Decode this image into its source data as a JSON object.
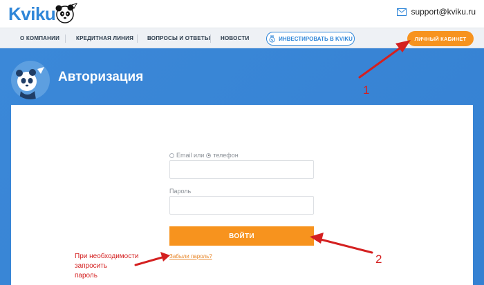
{
  "header": {
    "logo_text": "Kviku",
    "support_email": "support@kviku.ru"
  },
  "nav": {
    "items": [
      "О КОМПАНИИ",
      "КРЕДИТНАЯ ЛИНИЯ",
      "ВОПРОСЫ И ОТВЕТЫ",
      "НОВОСТИ"
    ],
    "invest_label": "ИНВЕСТИРОВАТЬ В KVIKU",
    "cabinet_label": "ЛИЧНЫЙ КАБИНЕТ"
  },
  "page": {
    "title": "Авторизация"
  },
  "form": {
    "radio_email_label": "Email или",
    "radio_phone_label": "телефон",
    "password_label": "Пароль",
    "login_button": "ВОЙТИ",
    "forgot_link": "Забыли пароль?"
  },
  "annotations": {
    "note_line1": "При необходимости",
    "note_line2": "запросить",
    "note_line3": "пароль",
    "marker_1": "1",
    "marker_2": "2"
  },
  "colors": {
    "brand_blue": "#2f86d8",
    "accent_orange": "#f7931e",
    "annotation_red": "#d42020"
  },
  "icons": {
    "logo": "panda-logo-icon",
    "mail": "envelope-icon",
    "invest": "money-bag-icon"
  }
}
